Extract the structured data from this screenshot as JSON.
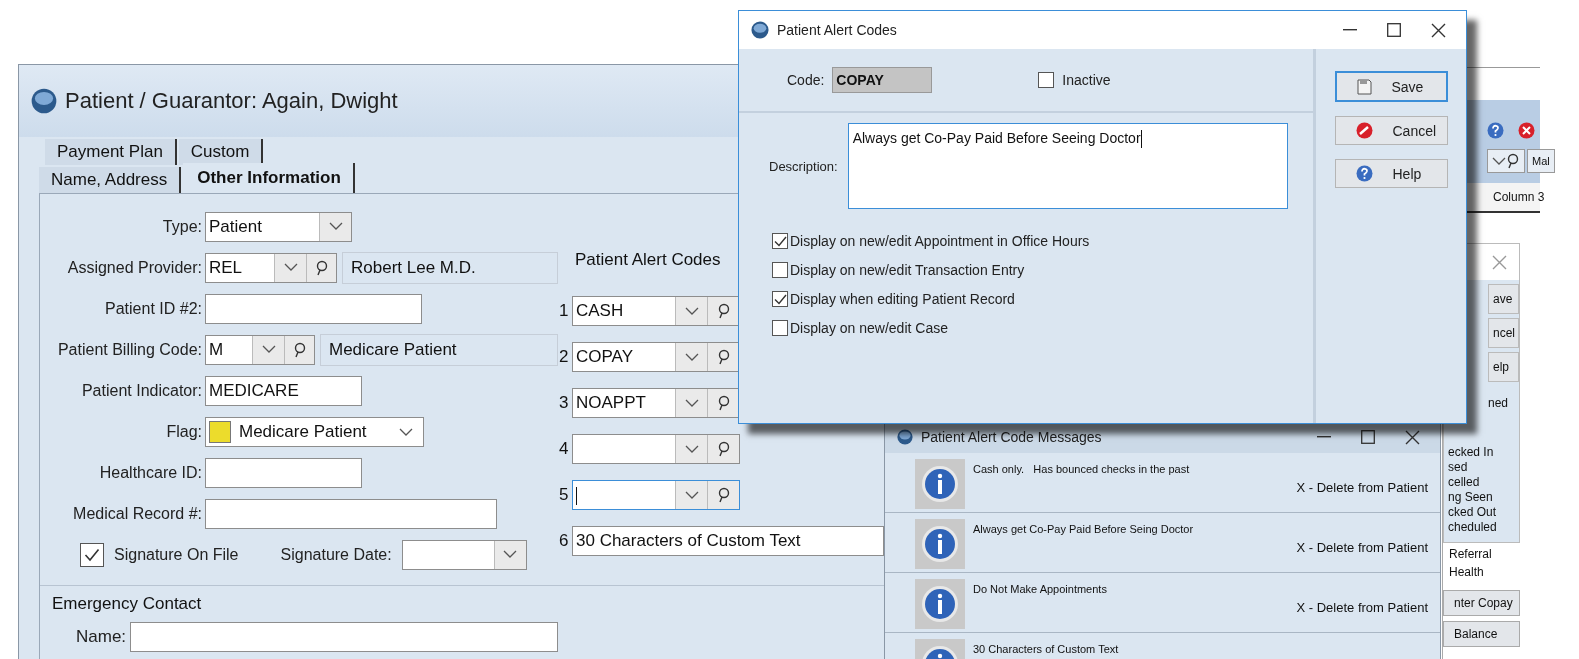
{
  "patient_window": {
    "title": "Patient / Guarantor: Again, Dwight",
    "tab_rows": [
      [
        {
          "label": "Payment Plan",
          "selected": false
        },
        {
          "label": "Custom",
          "selected": false
        }
      ],
      [
        {
          "label": "Name, Address",
          "selected": false
        },
        {
          "label": "Other Information",
          "selected": true
        }
      ]
    ],
    "fields": [
      {
        "kind": "combo",
        "label": "Type:",
        "value": "Patient"
      },
      {
        "kind": "lookup",
        "label": "Assigned Provider:",
        "value": "REL",
        "description": "Robert Lee M.D."
      },
      {
        "kind": "text",
        "label": "Patient ID #2:"
      },
      {
        "kind": "lookup",
        "label": "Patient Billing Code:",
        "value": "M",
        "description": "Medicare Patient"
      },
      {
        "kind": "text",
        "label": "Patient Indicator:",
        "value": "MEDICARE"
      },
      {
        "kind": "flag",
        "label": "Flag:",
        "value": "Medicare Patient"
      },
      {
        "kind": "text",
        "label": "Healthcare ID:"
      },
      {
        "kind": "text",
        "label": "Medical Record #:"
      }
    ],
    "signature": {
      "label": "Signature On File",
      "checked": true,
      "date_label": "Signature Date:"
    },
    "alert_codes": {
      "title": "Patient Alert Codes",
      "rows": [
        {
          "number": "1",
          "value": "CASH",
          "focused": false
        },
        {
          "number": "2",
          "value": "COPAY",
          "focused": false
        },
        {
          "number": "3",
          "value": "NOAPPT",
          "focused": false
        },
        {
          "number": "4",
          "focused": false
        },
        {
          "number": "5",
          "focused": true
        }
      ],
      "custom": {
        "number": "6",
        "value": "30 Characters of Custom Text"
      }
    },
    "emergency_contact": {
      "title": "Emergency Contact",
      "name_label": "Name:"
    }
  },
  "alert_dialog": {
    "title": "Patient Alert Codes",
    "code_label": "Code:",
    "code": "COPAY",
    "inactive": {
      "label": "Inactive",
      "checked": false
    },
    "description_label": "Description:",
    "description": "Always get Co-Pay Paid Before Seeing Doctor",
    "options": [
      {
        "label": "Display on new/edit Appointment in Office Hours",
        "checked": true
      },
      {
        "label": "Display on new/edit Transaction Entry",
        "checked": false
      },
      {
        "label": "Display when editing Patient Record",
        "checked": true
      },
      {
        "label": "Display on new/edit Case",
        "checked": false
      }
    ],
    "buttons": [
      {
        "kind": "save",
        "label": "Save",
        "focused": true
      },
      {
        "kind": "cancel",
        "label": "Cancel",
        "focused": false
      },
      {
        "kind": "help",
        "label": "Help",
        "focused": false
      }
    ]
  },
  "messages_window": {
    "title": "Patient Alert Code Messages",
    "messages": [
      {
        "text": "Cash only.   Has bounced checks in the past",
        "action": "X - Delete from Patient"
      },
      {
        "text": "Always get Co-Pay Paid Before Seing Doctor",
        "action": "X - Delete from Patient"
      },
      {
        "text": "Do Not Make Appointments",
        "action": "X - Delete from Patient"
      },
      {
        "text": "30 Characters of Custom Text"
      }
    ]
  },
  "background_window": {
    "field_value": "Mal",
    "column_header": "Column 3",
    "dialog_buttons": [
      "ave",
      "ncel",
      "elp"
    ],
    "statuses": [
      "ned",
      "ecked In",
      "sed",
      "celled",
      "ng Seen",
      "cked Out",
      "cheduled"
    ],
    "links": [
      "Referral",
      "Health"
    ],
    "buttons": [
      "nter Copay",
      "Balance"
    ]
  }
}
